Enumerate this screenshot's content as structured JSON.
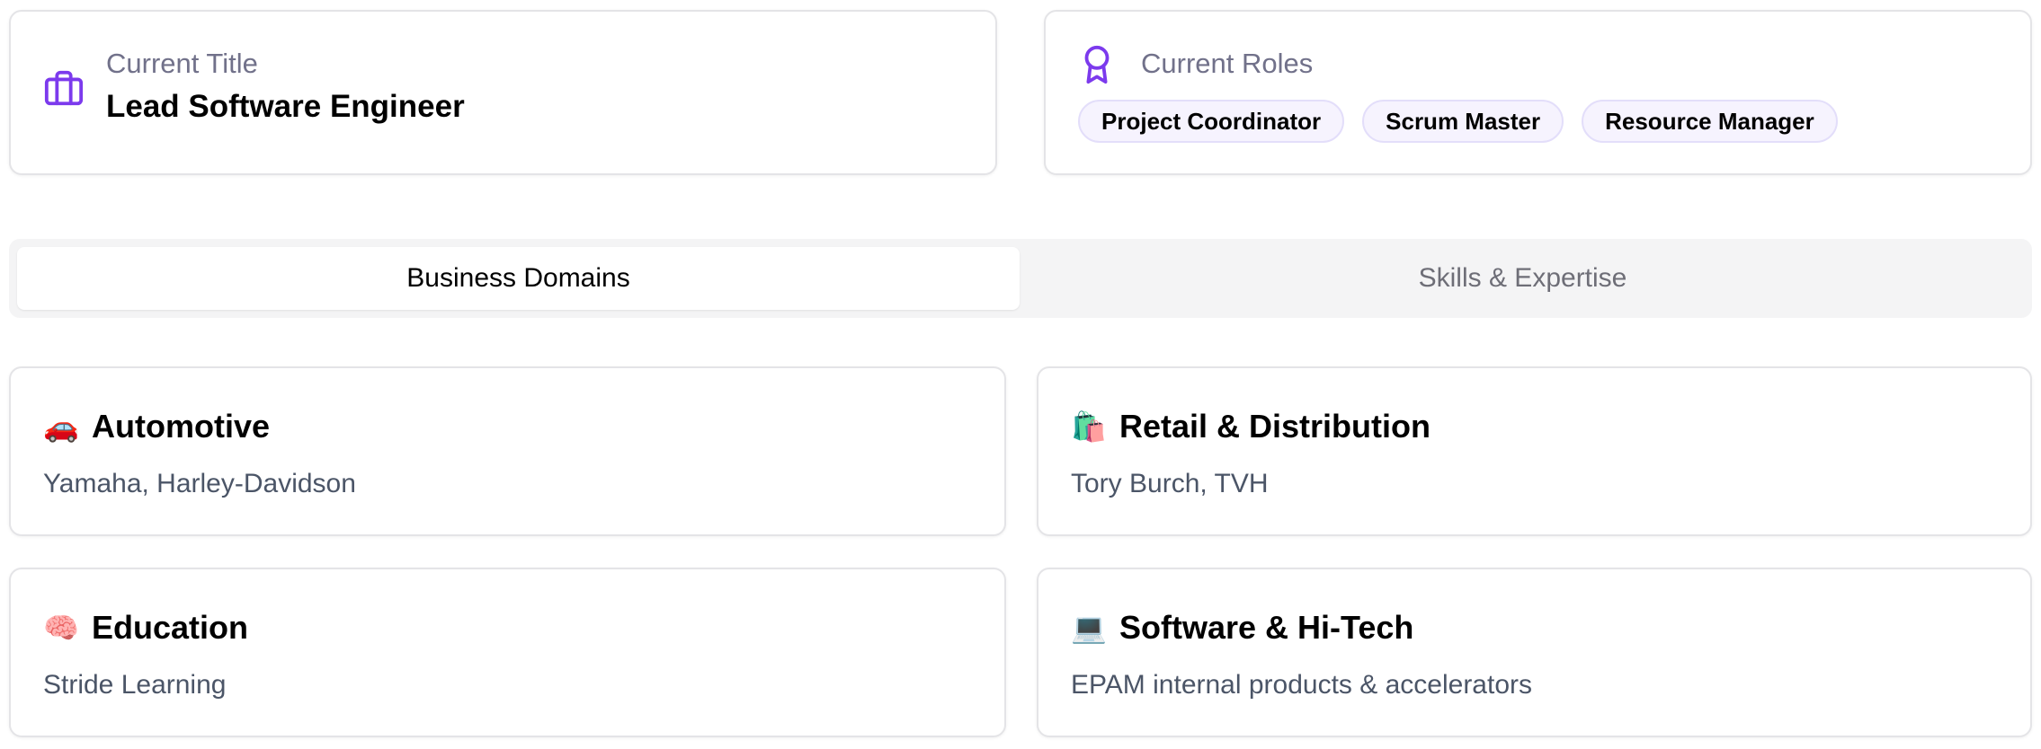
{
  "current_title": {
    "label": "Current Title",
    "value": "Lead Software Engineer",
    "icon": "briefcase-icon"
  },
  "current_roles": {
    "label": "Current Roles",
    "icon": "award-icon",
    "roles": [
      "Project Coordinator",
      "Scrum Master",
      "Resource Manager"
    ]
  },
  "tabs": [
    {
      "label": "Business Domains",
      "active": true
    },
    {
      "label": "Skills & Expertise",
      "active": false
    }
  ],
  "domains": [
    {
      "emoji": "🚗",
      "title": "Automotive",
      "clients": "Yamaha, Harley-Davidson"
    },
    {
      "emoji": "🛍️",
      "title": "Retail & Distribution",
      "clients": "Tory Burch, TVH"
    },
    {
      "emoji": "🧠",
      "title": "Education",
      "clients": "Stride Learning"
    },
    {
      "emoji": "💻",
      "title": "Software & Hi-Tech",
      "clients": "EPAM internal products & accelerators"
    }
  ],
  "colors": {
    "accent": "#7c3aed",
    "muted_text": "#71718a",
    "client_text": "#4b5567",
    "badge_bg": "#f6f3fe"
  }
}
